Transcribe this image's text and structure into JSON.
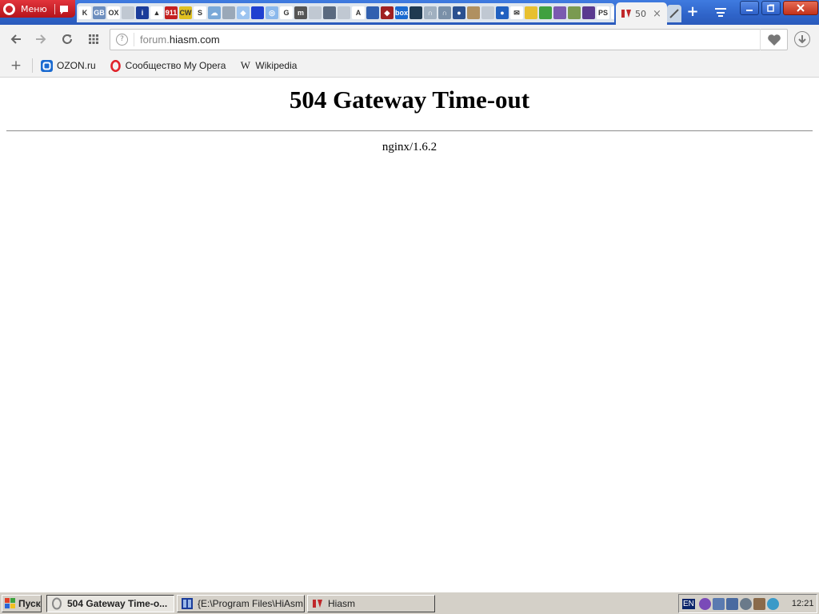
{
  "browser": {
    "menu_label": "Меню",
    "active_tab": {
      "title": "50",
      "close_glyph": "×"
    },
    "new_tab_glyph": "+",
    "address_bar": {
      "url_subdomain": "forum.",
      "url_domain": "hiasm.com"
    },
    "pinned_icons": [
      {
        "name": "kinopoisk-icon",
        "text": "K",
        "bg": "#ffffff",
        "light": true
      },
      {
        "name": "gbi-icon",
        "text": "GB",
        "bg": "#6d8fbf"
      },
      {
        "name": "olx-icon",
        "text": "OX",
        "bg": "#ffffff",
        "light": true
      },
      {
        "name": "page-icon",
        "text": "",
        "bg": "#c0c8d2"
      },
      {
        "name": "info-icon",
        "text": "i",
        "bg": "#1a3c9a"
      },
      {
        "name": "alert-icon",
        "text": "▲",
        "bg": "#ffffff",
        "light": true
      },
      {
        "name": "911-icon",
        "text": "911",
        "bg": "#c42020"
      },
      {
        "name": "cw-icon",
        "text": "CW",
        "bg": "#e0c020",
        "light": true
      },
      {
        "name": "s-icon",
        "text": "S",
        "bg": "#ffffff",
        "light": true
      },
      {
        "name": "weather-icon",
        "text": "☁",
        "bg": "#7aa9d8"
      },
      {
        "name": "disk-icon",
        "text": "",
        "bg": "#9aa8b8"
      },
      {
        "name": "compass-icon",
        "text": "◆",
        "bg": "#9dc4f0"
      },
      {
        "name": "grid-icon",
        "text": "",
        "bg": "#2040d0"
      },
      {
        "name": "navigator-icon",
        "text": "◎",
        "bg": "#8bb8ec"
      },
      {
        "name": "google-icon",
        "text": "G",
        "bg": "#ffffff",
        "light": true
      },
      {
        "name": "m-icon",
        "text": "m",
        "bg": "#555555"
      },
      {
        "name": "doc-icon",
        "text": "",
        "bg": "#c0c8d2"
      },
      {
        "name": "monitor-icon",
        "text": "",
        "bg": "#5a6a80"
      },
      {
        "name": "page2-icon",
        "text": "",
        "bg": "#c0c8d2"
      },
      {
        "name": "circle-icon",
        "text": "A",
        "bg": "#ffffff",
        "light": true
      },
      {
        "name": "film-icon",
        "text": "",
        "bg": "#3060b0"
      },
      {
        "name": "diamond-icon",
        "text": "◆",
        "bg": "#a02020"
      },
      {
        "name": "box-icon",
        "text": "box",
        "bg": "#1a6ad0"
      },
      {
        "name": "hiasm-grid-icon",
        "text": "",
        "bg": "#203a50"
      },
      {
        "name": "headset-icon",
        "text": "∩",
        "bg": "#a0b0c0"
      },
      {
        "name": "headphones-icon",
        "text": "∩",
        "bg": "#7a90a8"
      },
      {
        "name": "user-icon",
        "text": "●",
        "bg": "#2a5090"
      },
      {
        "name": "books-icon",
        "text": "",
        "bg": "#b09060"
      },
      {
        "name": "page3-icon",
        "text": "",
        "bg": "#c0c8d2"
      },
      {
        "name": "earth-icon",
        "text": "●",
        "bg": "#2060c0"
      },
      {
        "name": "mail-icon",
        "text": "✉",
        "bg": "#ffffff",
        "light": true
      },
      {
        "name": "shield-icon",
        "text": "",
        "bg": "#e8c030"
      },
      {
        "name": "leaf-icon",
        "text": "",
        "bg": "#40a040"
      },
      {
        "name": "square-icon",
        "text": "",
        "bg": "#7a5ab0"
      },
      {
        "name": "photo-icon",
        "text": "",
        "bg": "#7a9a50"
      },
      {
        "name": "square2-icon",
        "text": "",
        "bg": "#5a3a90"
      },
      {
        "name": "ps-icon",
        "text": "PS",
        "bg": "#ffffff",
        "light": true
      },
      {
        "name": "rocket-icon",
        "text": "➶",
        "bg": "#ffffff",
        "light": true
      }
    ]
  },
  "bookmarks": [
    {
      "label": "OZON.ru",
      "icon": "ozon-icon"
    },
    {
      "label": "Сообщество My Opera",
      "icon": "opera-icon"
    },
    {
      "label": "Wikipedia",
      "icon": "wikipedia-icon"
    }
  ],
  "page": {
    "title": "504 Gateway Time-out",
    "server_signature": "nginx/1.6.2"
  },
  "taskbar": {
    "start_label": "Пуск",
    "tasks": [
      {
        "label": "504 Gateway Time-o...",
        "active": true
      },
      {
        "label": "{E:\\Program Files\\HiAsm...",
        "active": false
      },
      {
        "label": "Hiasm",
        "active": false
      }
    ],
    "lang": "EN",
    "clock": "12:21"
  }
}
